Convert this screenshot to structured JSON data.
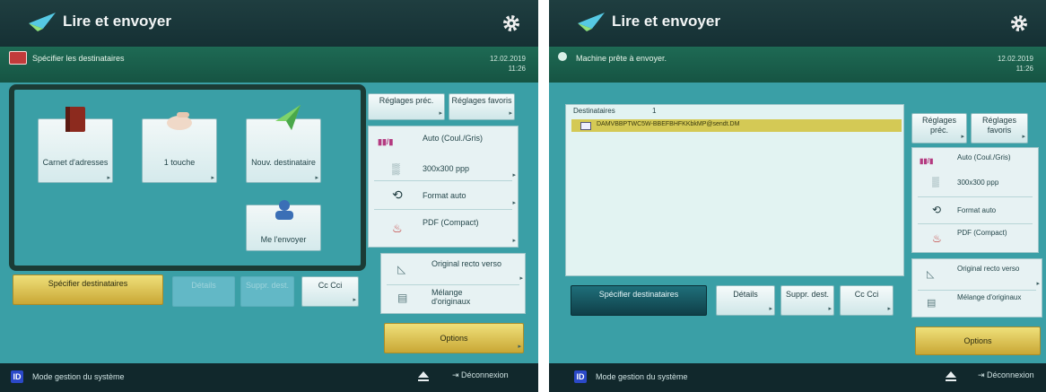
{
  "left": {
    "app_title": "Lire et envoyer",
    "status": "Spécifier les destinataires",
    "date": "12.02.2019",
    "time": "11:26",
    "tiles": {
      "address_book": "Carnet d'adresses",
      "one_touch": "1 touche",
      "new_dest": "Nouv. destinataire",
      "send_me": "Me l'envoyer"
    },
    "buttons": {
      "specify": "Spécifier destinataires",
      "details": "Détails",
      "delete": "Suppr. dest.",
      "cc": "Cc Cci"
    },
    "settings": {
      "prev": "Réglages préc.",
      "favs": "Réglages favoris",
      "color": "Auto (Coul./Gris)",
      "resolution": "300x300 ppp",
      "format": "Format auto",
      "filetype": "PDF (Compact)",
      "original": "Original recto verso",
      "mix": "Mélange d'originaux",
      "options": "Options"
    },
    "system_mode": "Mode gestion du système",
    "logout": "Déconnexion"
  },
  "right": {
    "app_title": "Lire et envoyer",
    "status": "Machine prête à envoyer.",
    "date": "12.02.2019",
    "time": "11:26",
    "list_header": "Destinataires",
    "list_count": "1",
    "recipient": "DAMVBBPTWC5W-BBEFBHFKKbkMP@sendt.DM",
    "buttons": {
      "specify": "Spécifier destinataires",
      "details": "Détails",
      "delete": "Suppr. dest.",
      "cc": "Cc Cci"
    },
    "settings": {
      "prev": "Réglages préc.",
      "favs": "Réglages favoris",
      "color": "Auto (Coul./Gris)",
      "resolution": "300x300 ppp",
      "format": "Format auto",
      "filetype": "PDF (Compact)",
      "original": "Original recto verso",
      "mix": "Mélange d'originaux",
      "options": "Options"
    },
    "system_mode": "Mode gestion du système",
    "logout": "Déconnexion"
  },
  "colors": {
    "topbar": "#1f3e40",
    "statusbar": "#1e6a54",
    "work": "#3a9fa6",
    "gold": "#c9a735"
  }
}
